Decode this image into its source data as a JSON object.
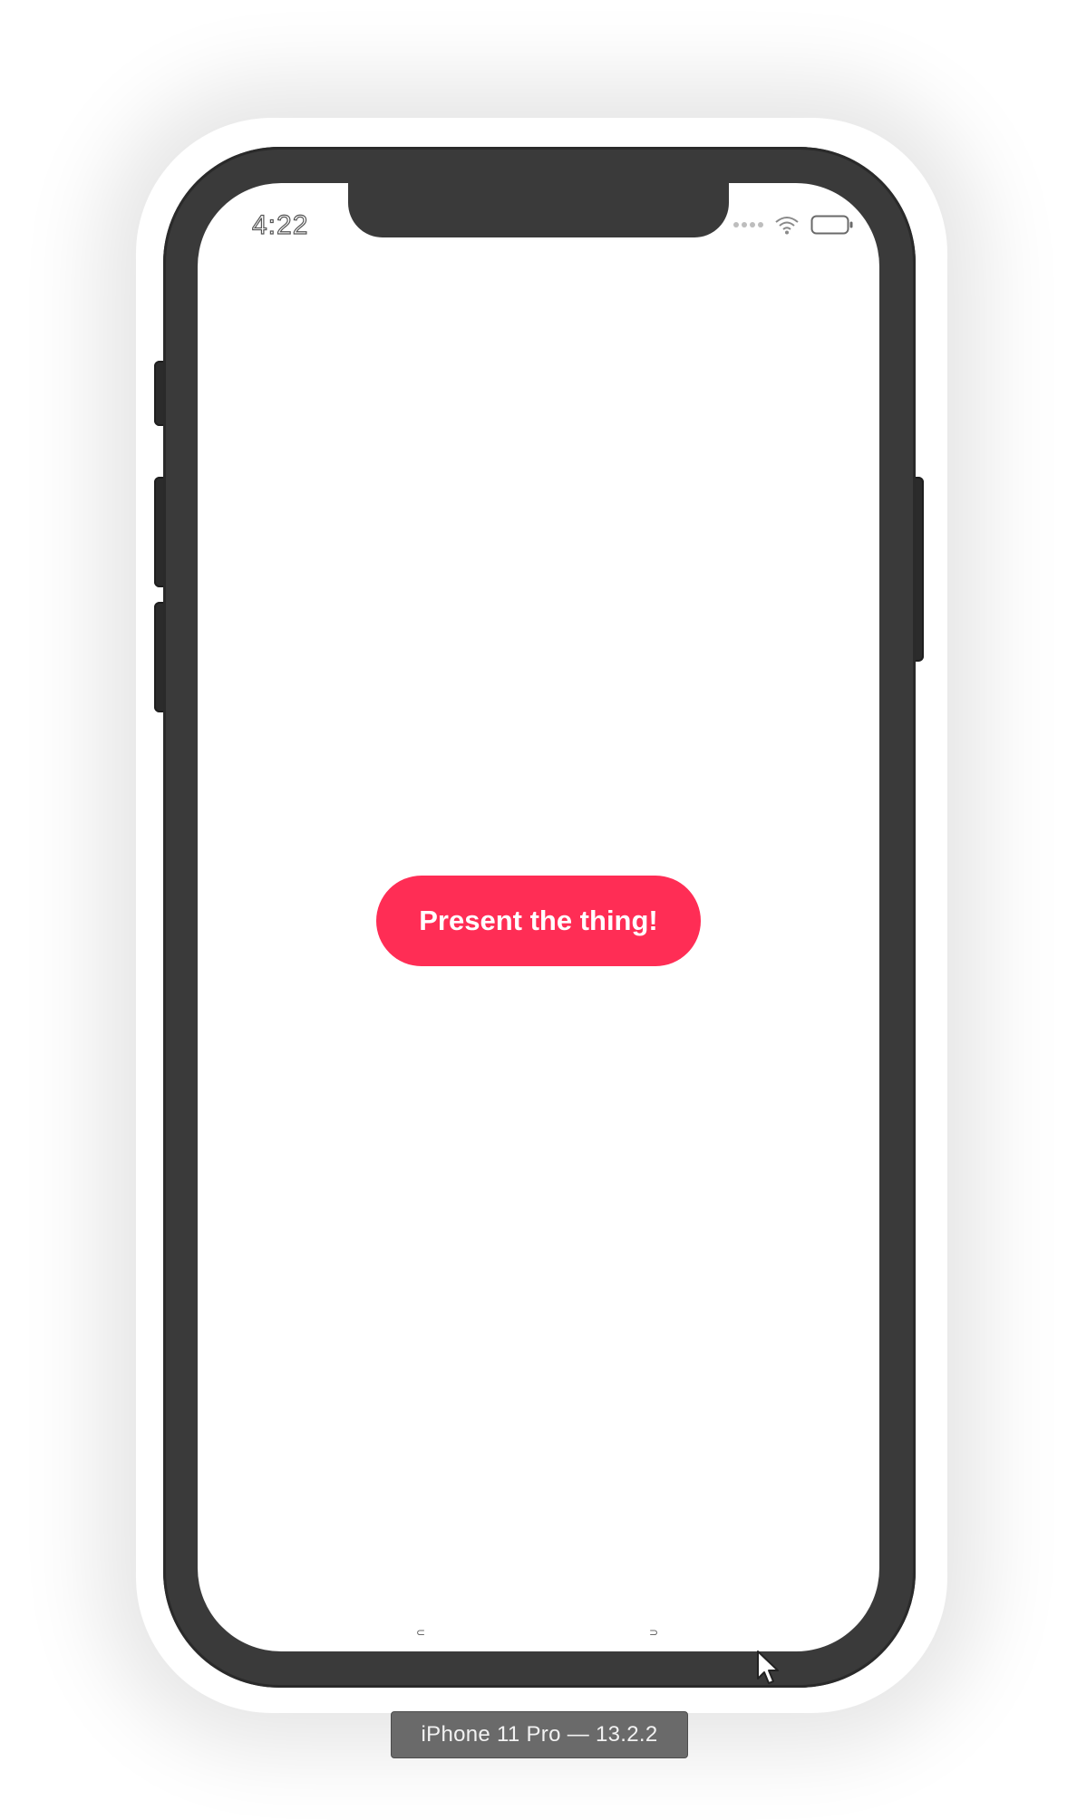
{
  "simulator": {
    "device_label": "iPhone 11 Pro — 13.2.2"
  },
  "status_bar": {
    "time": "4:22",
    "icons": [
      "cellular-signal-icon",
      "wifi-icon",
      "battery-icon"
    ]
  },
  "app": {
    "primary_button_label": "Present the thing!"
  },
  "colors": {
    "accent": "#ff2d55",
    "device_frame": "#3a3a3a",
    "screen_background": "#ffffff"
  }
}
